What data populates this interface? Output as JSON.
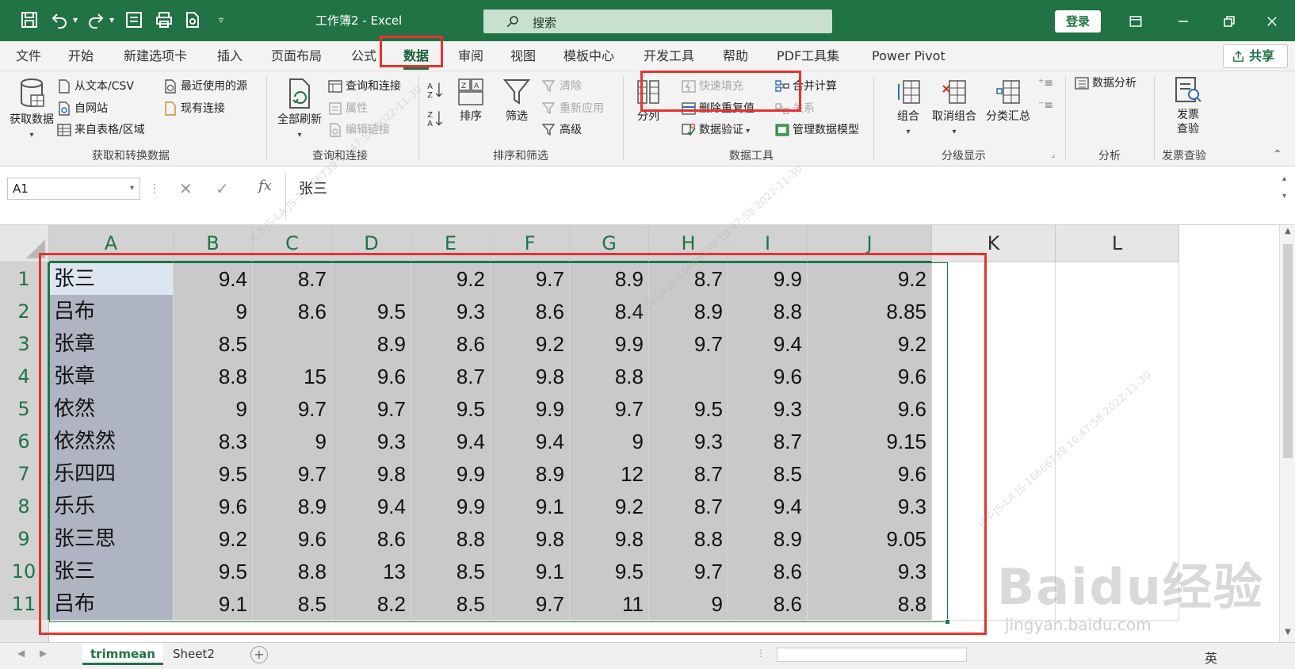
{
  "titlebar": {
    "doc_title": "工作簿2 - Excel",
    "search_label": "搜索",
    "login_label": "登录",
    "accent": "#217346"
  },
  "menu": {
    "items": [
      "文件",
      "开始",
      "新建选项卡",
      "插入",
      "页面布局",
      "公式",
      "数据",
      "审阅",
      "视图",
      "模板中心",
      "开发工具",
      "帮助",
      "PDF工具集",
      "Power Pivot"
    ],
    "active": "数据",
    "share_label": "共享"
  },
  "ribbon": {
    "get_data": {
      "big_label": "获取数据",
      "items": [
        "从文本/CSV",
        "自网站",
        "来自表格/区域",
        "最近使用的源",
        "现有连接"
      ],
      "group_label": "获取和转换数据"
    },
    "query": {
      "big_label": "全部刷新",
      "items": [
        "查询和连接",
        "属性",
        "编辑链接"
      ],
      "group_label": "查询和连接"
    },
    "sort_filter": {
      "sort_label": "排序",
      "filter_label": "筛选",
      "items": [
        "清除",
        "重新应用",
        "高级"
      ],
      "group_label": "排序和筛选"
    },
    "data_tools": {
      "split_label": "分列",
      "items": [
        "快速填充",
        "删除重复值",
        "数据验证",
        "合并计算",
        "关系",
        "管理数据模型"
      ],
      "group_label": "数据工具"
    },
    "outline": {
      "items": [
        "组合",
        "取消组合",
        "分类汇总"
      ],
      "group_label": "分级显示"
    },
    "analysis": {
      "item": "数据分析",
      "group_label": "分析"
    },
    "invoice": {
      "item": "发票查验",
      "group_label": "发票查验"
    }
  },
  "formula_bar": {
    "name_box": "A1",
    "fx": "fx",
    "content": "张三"
  },
  "grid": {
    "columns": [
      "A",
      "B",
      "C",
      "D",
      "E",
      "F",
      "G",
      "H",
      "I",
      "J",
      "K",
      "L"
    ],
    "rows": [
      {
        "n": "1",
        "cells": [
          "张三",
          "9.4",
          "8.7",
          "",
          "9.2",
          "9.7",
          "8.9",
          "8.7",
          "9.9",
          "9.2"
        ]
      },
      {
        "n": "2",
        "cells": [
          "吕布",
          "9",
          "8.6",
          "9.5",
          "9.3",
          "8.6",
          "8.4",
          "8.9",
          "8.8",
          "8.85"
        ]
      },
      {
        "n": "3",
        "cells": [
          "张章",
          "8.5",
          "",
          "8.9",
          "8.6",
          "9.2",
          "9.9",
          "9.7",
          "9.4",
          "9.2"
        ]
      },
      {
        "n": "4",
        "cells": [
          "张章",
          "8.8",
          "15",
          "9.6",
          "8.7",
          "9.8",
          "8.8",
          "",
          "9.6",
          "9.6"
        ]
      },
      {
        "n": "5",
        "cells": [
          "依然",
          "9",
          "9.7",
          "9.7",
          "9.5",
          "9.9",
          "9.7",
          "9.5",
          "9.3",
          "9.6"
        ]
      },
      {
        "n": "6",
        "cells": [
          "依然然",
          "8.3",
          "9",
          "9.3",
          "9.4",
          "9.4",
          "9",
          "9.3",
          "8.7",
          "9.15"
        ]
      },
      {
        "n": "7",
        "cells": [
          "乐四四",
          "9.5",
          "9.7",
          "9.8",
          "9.9",
          "8.9",
          "12",
          "8.7",
          "8.5",
          "9.6"
        ]
      },
      {
        "n": "8",
        "cells": [
          "乐乐",
          "9.6",
          "8.9",
          "9.4",
          "9.9",
          "9.1",
          "9.2",
          "8.7",
          "9.4",
          "9.3"
        ]
      },
      {
        "n": "9",
        "cells": [
          "张三思",
          "9.2",
          "9.6",
          "8.6",
          "8.8",
          "9.8",
          "9.8",
          "8.8",
          "8.9",
          "9.05"
        ]
      },
      {
        "n": "10",
        "cells": [
          "张三",
          "9.5",
          "8.8",
          "13",
          "8.5",
          "9.1",
          "9.5",
          "9.7",
          "8.6",
          "9.3"
        ]
      },
      {
        "n": "11",
        "cells": [
          "吕布",
          "9.1",
          "8.5",
          "8.2",
          "8.5",
          "9.7",
          "11",
          "9",
          "8.6",
          "8.8"
        ]
      }
    ]
  },
  "sheets": {
    "tabs": [
      "trimmean",
      "Sheet2"
    ],
    "active": "trimmean",
    "status_lang": "英"
  },
  "watermark": {
    "brand": "Baidu经验",
    "url": "jingyan.baidu.com",
    "stamp": "ICT-JS-LA JS-16666739 10:47:58 2022-11-30"
  },
  "colors": {
    "excel_green": "#217346",
    "annotation_red": "#e8322f",
    "selection_gray": "#c9c9c9"
  }
}
